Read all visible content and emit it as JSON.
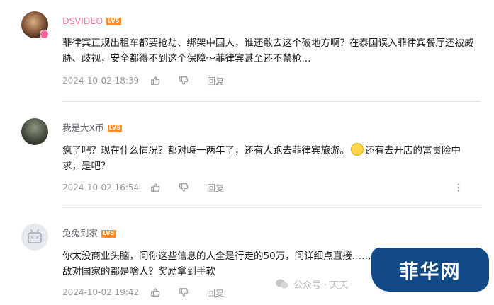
{
  "comments": [
    {
      "username": "DSVIDEO",
      "level": "LV5",
      "avatar_badge": "大",
      "content": "菲律宾正规出租车都要抢劫、绑架中国人，谁还敢去这个破地方啊？在泰国误入菲律宾餐厅还被威胁、歧视，安全都得不到这个保障～菲律宾甚至还不禁枪...",
      "time": "2024-10-02 18:39",
      "reply_label": "回复"
    },
    {
      "username": "我是大X币",
      "level": "LV5",
      "content_before_emoji": "疯了吧？现在什么情况？都对峙一两年了，还有人跑去菲律宾旅游。",
      "content_after_emoji": "还有去开店的富贵险中求，是吧？",
      "time": "2024-10-02 16:54",
      "reply_label": "回复"
    },
    {
      "username": "兔兔到家",
      "level": "LV5",
      "content": "你太没商业头脑，问你这些信息的人全是行走的50万，问详细点直接……敌对国家的都是啥人？奖励拿到手软",
      "time": "2024-10-02 19:42",
      "reply_label": "回复"
    }
  ],
  "watermark": {
    "text": "公众号 · 天天"
  },
  "brand": {
    "text": "菲华网"
  },
  "colors": {
    "vip_name": "#fb7299",
    "level_badge": "#ff8c28",
    "brand_bg": "#114a86"
  },
  "icons": [
    "like-icon",
    "dislike-icon",
    "more-icon",
    "wechat-icon"
  ]
}
